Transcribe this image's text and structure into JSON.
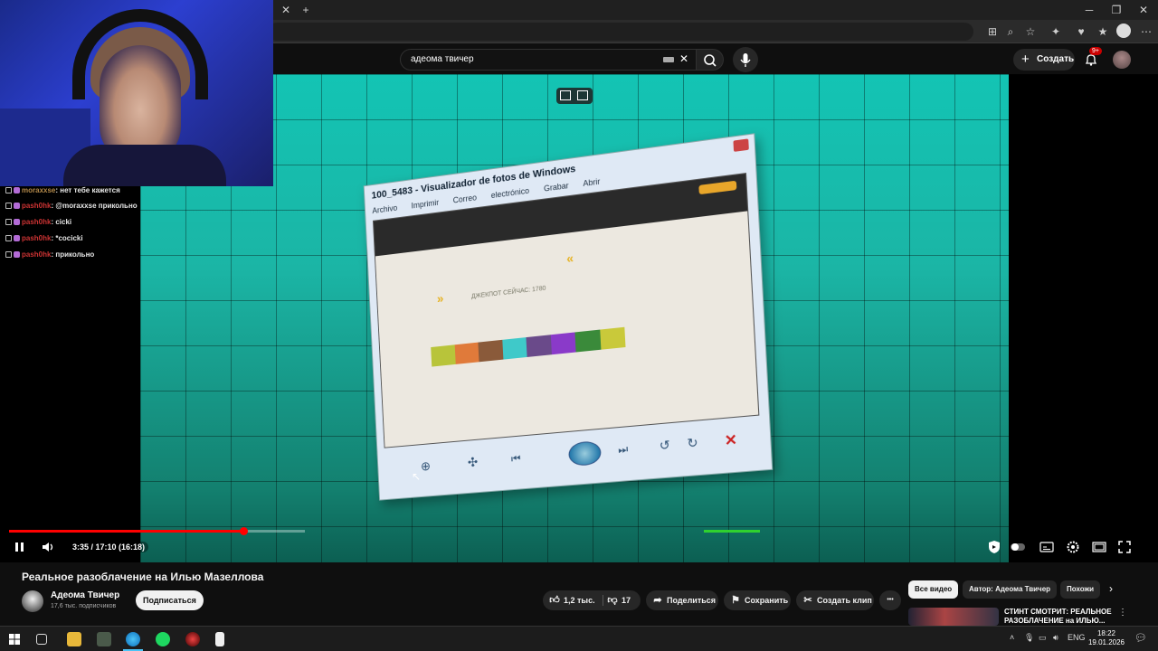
{
  "browser": {
    "tab_close": "✕",
    "new_tab": "+",
    "window_minimize": "─",
    "window_restore": "❐",
    "window_close": "✕"
  },
  "youtube_header": {
    "search_value": "адеома твичер",
    "create_label": "Создать",
    "notifications_badge": "9+"
  },
  "chat": {
    "messages": [
      {
        "user": "moraxxse",
        "text": ": нет тебе кажется"
      },
      {
        "user": "pash0hk",
        "text": ": @moraxxse прикольно"
      },
      {
        "user": "pash0hk",
        "text": ": cicki"
      },
      {
        "user": "pash0hk",
        "text": ": *cocicki"
      },
      {
        "user": "pash0hk",
        "text": ": прикольно"
      }
    ]
  },
  "video_content": {
    "viewer_title": "100_5483 - Visualizador de fotos de Windows",
    "viewer_menu": [
      "Archivo",
      "Imprimir",
      "Correo electrónico",
      "Grabar",
      "Abrir"
    ],
    "photo_caption": "ДЖЕКПОТ СЕЙЧАС: 1780"
  },
  "player": {
    "progress_fraction": 0.27,
    "time_label": "3:35 / 17:10 (16:18)"
  },
  "video_info": {
    "title": "Реальное разоблачение на Илью Мазеллова",
    "channel_name": "Адеома Твичер",
    "subscribers": "17,6 тыс. подписчиков",
    "subscribe_label": "Подписаться",
    "likes": "1,2 тыс.",
    "dislikes": "17",
    "share_label": "Поделиться",
    "save_label": "Сохранить",
    "clip_label": "Создать клип",
    "more_label": "•••"
  },
  "chips": {
    "all_videos": "Все видео",
    "author": "Автор: Адеома Твичер",
    "similar": "Похожи"
  },
  "recommendation": {
    "title": "СТИНТ СМОТРИТ: РЕАЛЬНОЕ РАЗОБЛАЧЕНИЕ на ИЛЬЮ..."
  },
  "taskbar": {
    "language": "ENG",
    "time": "18:22",
    "date": "19.01.2026"
  }
}
